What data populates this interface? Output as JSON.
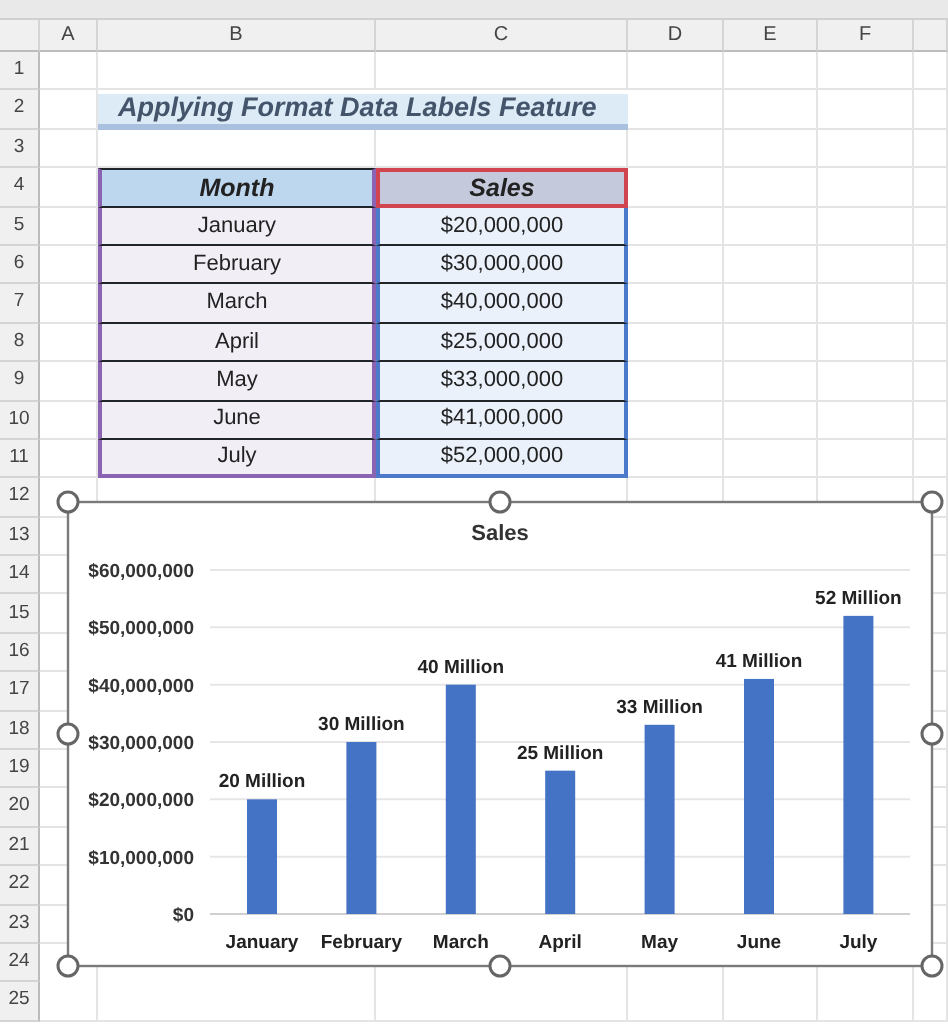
{
  "columns": [
    "A",
    "B",
    "C",
    "D",
    "E",
    "F"
  ],
  "rows": [
    "1",
    "2",
    "3",
    "4",
    "5",
    "6",
    "7",
    "8",
    "9",
    "10",
    "11",
    "12",
    "13",
    "14",
    "15",
    "16",
    "17",
    "18",
    "19",
    "20",
    "21",
    "22",
    "23",
    "24",
    "25"
  ],
  "title": "Applying Format Data Labels Feature",
  "table": {
    "columns": [
      "Month",
      "Sales"
    ],
    "rows": [
      [
        "January",
        "$20,000,000"
      ],
      [
        "February",
        "$30,000,000"
      ],
      [
        "March",
        "$40,000,000"
      ],
      [
        "April",
        "$25,000,000"
      ],
      [
        "May",
        "$33,000,000"
      ],
      [
        "June",
        "$41,000,000"
      ],
      [
        "July",
        "$52,000,000"
      ]
    ]
  },
  "chart": {
    "selected": true,
    "chart_data": {
      "type": "bar",
      "title": "Sales",
      "categories": [
        "January",
        "February",
        "March",
        "April",
        "May",
        "June",
        "July"
      ],
      "grid": true,
      "series": [
        {
          "color": "#4472c4",
          "values": [
            20000000,
            30000000,
            40000000,
            25000000,
            33000000,
            41000000,
            52000000
          ]
        }
      ],
      "ylim": [
        0,
        60000000
      ],
      "yticks": [
        {
          "value": 0,
          "label": "$0"
        },
        {
          "value": 10000000,
          "label": "$10,000,000"
        },
        {
          "value": 20000000,
          "label": "$20,000,000"
        },
        {
          "value": 30000000,
          "label": "$30,000,000"
        },
        {
          "value": 40000000,
          "label": "$40,000,000"
        },
        {
          "value": 50000000,
          "label": "$50,000,000"
        },
        {
          "value": 60000000,
          "label": "$60,000,000"
        }
      ],
      "value_labels": [
        "20 Million",
        "30 Million",
        "40 Million",
        "25 Million",
        "33 Million",
        "41 Million",
        "52 Million"
      ]
    }
  }
}
